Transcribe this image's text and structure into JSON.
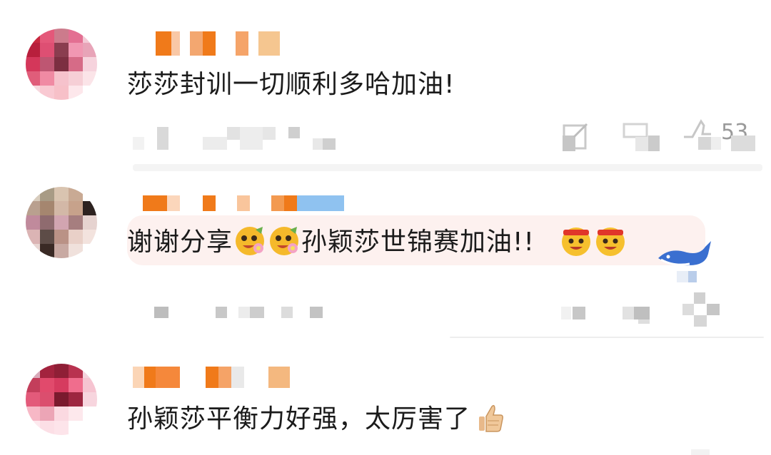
{
  "comments": [
    {
      "text": "莎莎封训一切顺利多哈加油!"
    },
    {
      "text_a": "谢谢分享",
      "text_b": "孙颖莎世锦赛加油!!"
    },
    {
      "text": "孙颖莎平衡力好强，太厉害了"
    }
  ],
  "like_count": "53",
  "colors": {
    "text": "#1b1b1b",
    "meta": "#9a9a9a",
    "username": "#f07a1a",
    "highlight": "#fdf1ef"
  }
}
